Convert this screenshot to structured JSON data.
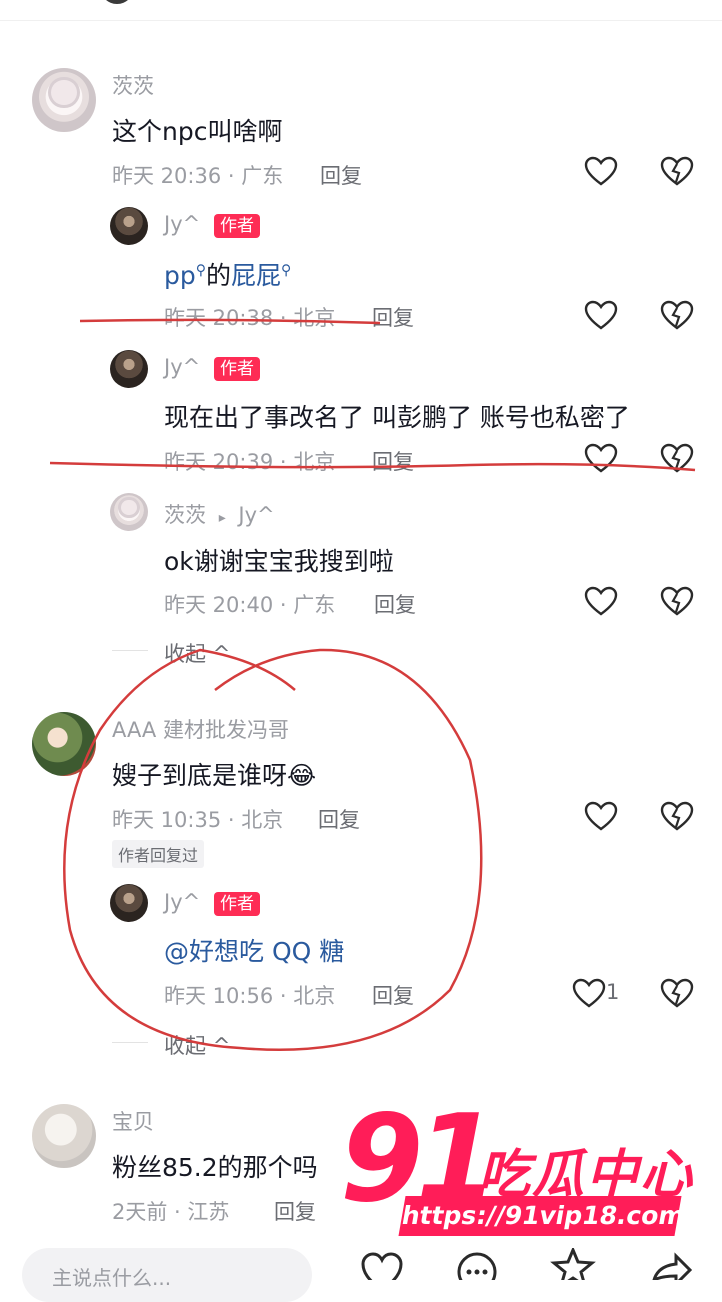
{
  "comments": [
    {
      "user": "茨茨",
      "text": "这个npc叫啥啊",
      "time": "昨天 20:36 · 广东",
      "reply": "回复"
    },
    {
      "user": "Jy^",
      "badge": "作者",
      "text_a": "pp",
      "text_b": "的",
      "text_c": "屁屁",
      "time": "昨天 20:38 · 北京",
      "reply": "回复"
    },
    {
      "user": "Jy^",
      "badge": "作者",
      "text": "现在出了事改名了 叫彭鹏了 账号也私密了",
      "time": "昨天 20:39 · 北京",
      "reply": "回复"
    },
    {
      "user": "茨茨",
      "arrow": "▸",
      "target": "Jy^",
      "text": "ok谢谢宝宝我搜到啦",
      "time": "昨天 20:40 · 广东",
      "reply": "回复"
    },
    {
      "user": "AAA 建材批发冯哥",
      "text": "嫂子到底是谁呀",
      "emoji": "😂",
      "time": "昨天 10:35 · 北京",
      "reply": "回复",
      "tag": "作者回复过"
    },
    {
      "user": "Jy^",
      "badge": "作者",
      "text": "@好想吃 QQ 糖",
      "time": "昨天 10:56 · 北京",
      "reply": "回复",
      "likes": "1"
    },
    {
      "user": "宝贝",
      "text": "粉丝85.2的那个吗",
      "time": "2天前 · 江苏",
      "reply": "回复"
    }
  ],
  "collapse_label": "收起",
  "collapse_arrow": "^",
  "input_placeholder": "主说点什么...",
  "watermark": {
    "number": "91",
    "title": "吃瓜中心",
    "url": "https://91vip18.com"
  },
  "colors": {
    "accent": "#fe2c55",
    "annotation": "#d43c3c",
    "link": "#2a5a9e"
  }
}
